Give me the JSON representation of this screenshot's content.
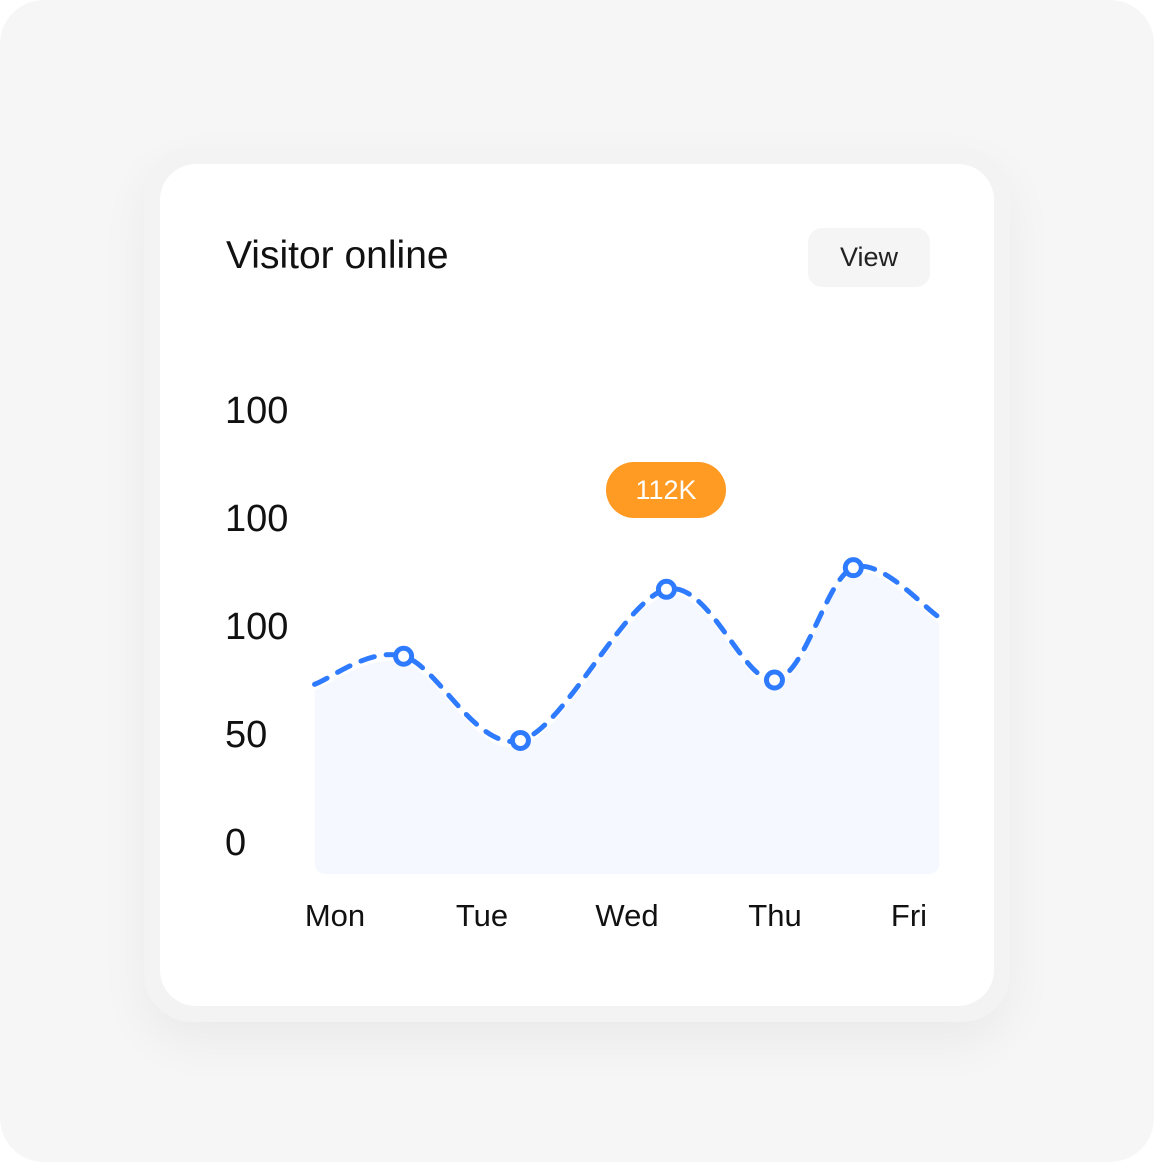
{
  "card": {
    "title": "Visitor online",
    "view_label": "View"
  },
  "chart_data": {
    "type": "area",
    "title": "Visitor online",
    "xlabel": "",
    "ylabel": "",
    "categories": [
      "Mon",
      "Tue",
      "Wed",
      "Thu",
      "Fri"
    ],
    "y_tick_labels": [
      "100",
      "100",
      "100",
      "50",
      "0"
    ],
    "ylim": [
      0,
      200
    ],
    "grid": false,
    "series": [
      {
        "x": [
          -0.14,
          0.47,
          1.27,
          2.27,
          3.01,
          3.55,
          4.14
        ],
        "y": [
          73,
          86,
          47,
          117,
          75,
          127,
          104
        ],
        "markers": [
          false,
          true,
          true,
          true,
          true,
          true,
          false
        ]
      }
    ],
    "annotation": {
      "label": "112K",
      "category_index": 2
    },
    "colors": {
      "line": "#2f7bff",
      "area": "#f5f8fe",
      "annotation": "#ff9a22"
    }
  }
}
